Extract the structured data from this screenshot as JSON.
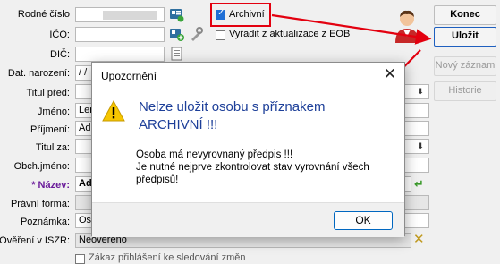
{
  "form": {
    "labels": {
      "rodne_cislo": "Rodné číslo",
      "ico": "IČO:",
      "dic": "DIČ:",
      "dat_narozeni": "Dat. narození:",
      "titul_pred": "Titul před:",
      "jmeno": "Jméno:",
      "prijmeni": "Příjmení:",
      "titul_za": "Titul za:",
      "obch_jmeno": "Obch.jméno:",
      "nazev": "* Název:",
      "pravni_forma": "Právní forma:",
      "poznamka": "Poznámka:",
      "overeni": "Ověření v ISZR:"
    },
    "values": {
      "dat_narozeni": "/   /",
      "jmeno": "Len",
      "prijmeni": "Ada",
      "nazev": "Ad",
      "poznamka": "Oso",
      "overeni": "Neověřeno"
    },
    "checkboxes": {
      "archivni": {
        "label": "Archivní",
        "checked": true
      },
      "vyradit": {
        "label": "Vyřadit z aktualizace z EOB",
        "checked": false
      },
      "zakaz": {
        "label": "Zákaz přihlášení ke sledování změn",
        "checked": false
      }
    }
  },
  "buttons": {
    "konec": "Konec",
    "ulozit": "Uložit",
    "novy_zaznam": "Nový záznam",
    "historie": "Historie"
  },
  "dialog": {
    "title": "Upozornění",
    "heading": "Nelze uložit osobu s příznakem ARCHIVNÍ !!!",
    "line1": "Osoba má nevyrovnaný předpis !!!",
    "line2": "Je nutné nejprve zkontrolovat stav vyrovnání všech předpisů!",
    "ok": "OK",
    "close_glyph": "✕"
  },
  "colors": {
    "accent_red": "#e3000f",
    "heading_blue": "#1d3f99",
    "nazev_purple": "#6a1b9a",
    "checked_blue": "#1f6fd6"
  },
  "icons": [
    "contact-card-icon",
    "add-contact-icon",
    "tools-icon",
    "document-icon",
    "warning-icon",
    "user-avatar-icon",
    "clear-icon",
    "checkmark-icon"
  ]
}
